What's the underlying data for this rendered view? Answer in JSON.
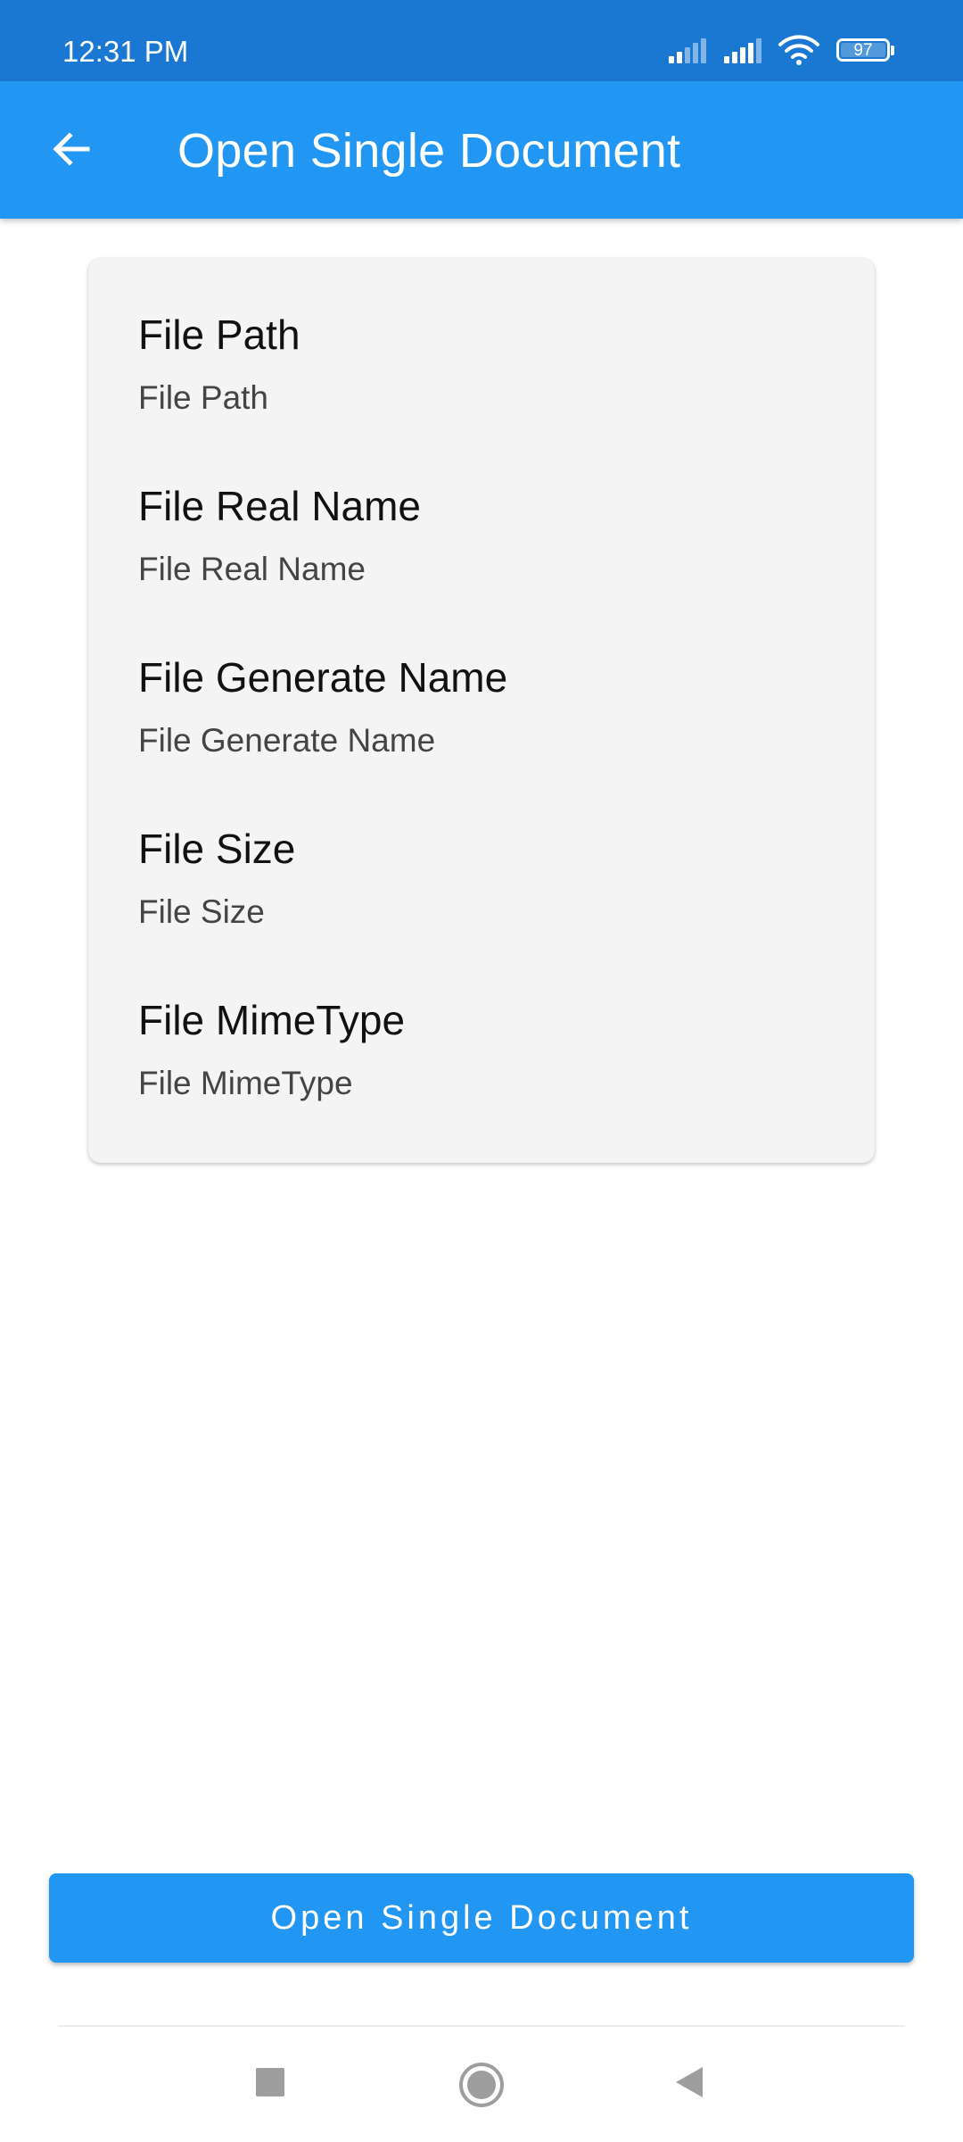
{
  "status_bar": {
    "time": "12:31 PM",
    "battery": "97",
    "icons": [
      "signal-icon",
      "signal-icon",
      "wifi-icon",
      "battery-icon"
    ]
  },
  "app_bar": {
    "title": "Open Single Document",
    "back_icon": "arrow-left-icon"
  },
  "file_info": {
    "fields": [
      {
        "title": "File Path",
        "value": "File Path"
      },
      {
        "title": "File Real Name",
        "value": "File Real Name"
      },
      {
        "title": "File Generate Name",
        "value": "File Generate Name"
      },
      {
        "title": "File Size",
        "value": "File Size"
      },
      {
        "title": "File MimeType",
        "value": "File MimeType"
      }
    ]
  },
  "action": {
    "button_label": "Open Single Document"
  },
  "navigation_bar": {
    "icons": [
      "recents-square-icon",
      "home-circle-icon",
      "back-triangle-icon"
    ]
  },
  "colors": {
    "status_bar": "#1a78d2",
    "primary": "#2196f3",
    "card_background": "#f4f4f4",
    "nav_icon": "#9e9e9e"
  }
}
